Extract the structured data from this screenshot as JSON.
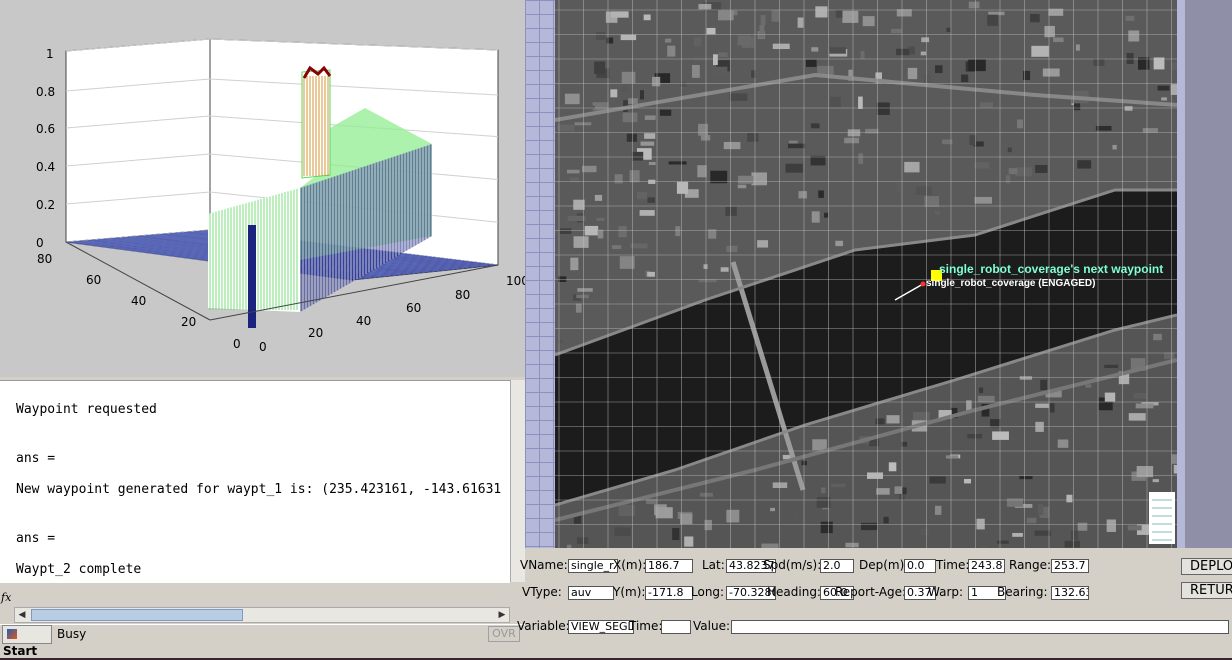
{
  "plot": {
    "z_ticks": [
      "0",
      "0.2",
      "0.4",
      "0.6",
      "0.8",
      "1"
    ],
    "x_ticks": [
      "0",
      "20",
      "40",
      "60",
      "80",
      "100"
    ],
    "y_ticks": [
      "0",
      "20",
      "40",
      "60",
      "80"
    ],
    "colors": {
      "surface_green": "#90ee90",
      "surface_blue": "#1a237e",
      "peak_red": "#8b0000",
      "axes_bg": "#ffffff"
    }
  },
  "command_window": {
    "lines": [
      "Waypoint requested",
      "ans =",
      "New waypoint generated for waypt_1 is: (235.423161, -143.61631",
      "ans =",
      "Waypt_2 complete"
    ],
    "fx_label": "fx",
    "start_label": "Start",
    "status": "Busy",
    "ovr": "OVR"
  },
  "map": {
    "waypoint_label": "single_robot_coverage's next waypoint",
    "vehicle_label": "single_robot_coverage (ENGAGED)",
    "colors": {
      "waypoint": "#ffff00",
      "label_cyan": "#7fffd4",
      "grid": "#bdbdbd"
    }
  },
  "vehicle_panel": {
    "row1": [
      {
        "label": "VName:",
        "value": "single_r"
      },
      {
        "label": "X(m):",
        "value": "186.7"
      },
      {
        "label": "Lat:",
        "value": "43.82375"
      },
      {
        "label": "Spd(m/s):",
        "value": "2.0"
      },
      {
        "label": "Dep(m):",
        "value": "0.0"
      },
      {
        "label": "Time:",
        "value": "243.8"
      },
      {
        "label": "Range:",
        "value": "253.7"
      }
    ],
    "row2": [
      {
        "label": "VType:",
        "value": "auv"
      },
      {
        "label": "Y(m):",
        "value": "-171.8"
      },
      {
        "label": "Long:",
        "value": "-70.3280"
      },
      {
        "label": "Heading:",
        "value": "60.0"
      },
      {
        "label": "Report-Age:",
        "value": "0.37"
      },
      {
        "label": "Warp:",
        "value": "1"
      },
      {
        "label": "Bearing:",
        "value": "132.63"
      }
    ],
    "row3": [
      {
        "label": "Variable:",
        "value": "VIEW_SEGL"
      },
      {
        "label": "Time:",
        "value": ""
      },
      {
        "label": "Value:",
        "value": ""
      }
    ],
    "buttons": [
      "DEPLOY",
      "RETURN"
    ]
  }
}
